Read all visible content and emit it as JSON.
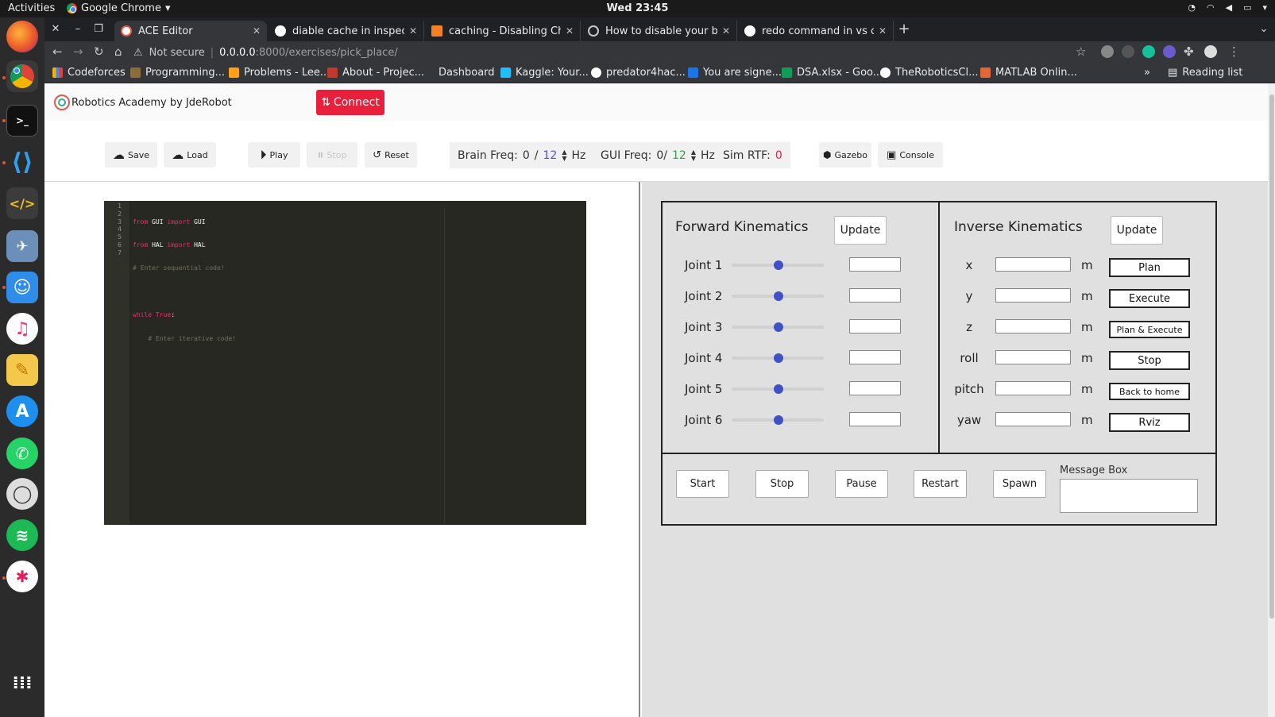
{
  "system": {
    "activities": "Activities",
    "app_name": "Google Chrome",
    "clock": "Wed 23:45"
  },
  "browser": {
    "tabs": [
      {
        "title": "ACE Editor",
        "active": true
      },
      {
        "title": "diable cache in inspect ch",
        "active": false
      },
      {
        "title": "caching - Disabling Chrom",
        "active": false
      },
      {
        "title": "How to disable your brow",
        "active": false
      },
      {
        "title": "redo command in vs code",
        "active": false
      }
    ],
    "security_label": "Not secure",
    "url_host": "0.0.0.0",
    "url_rest": ":8000/exercises/pick_place/",
    "bookmarks": [
      "Codeforces",
      "Programming...",
      "Problems - Lee...",
      "About - Projec...",
      "Dashboard",
      "Kaggle: Your...",
      "predator4hac...",
      "You are signe...",
      "DSA.xlsx - Goo...",
      "TheRoboticsCl...",
      "MATLAB Onlin..."
    ],
    "more_bookmarks": "»",
    "reading_list": "Reading list"
  },
  "app": {
    "brand": "Robotics Academy by JdeRobot",
    "connect_label": "Connect"
  },
  "toolbar": {
    "save": "Save",
    "load": "Load",
    "play": "Play",
    "stop": "Stop",
    "reset": "Reset",
    "brain_freq_label": "Brain Freq:",
    "brain_freq_value": "0",
    "brain_freq_sep": "/",
    "brain_freq_target": "12",
    "brain_freq_unit": "Hz",
    "gui_freq_label": "GUI Freq:",
    "gui_freq_value": "0/",
    "gui_freq_target": "12",
    "gui_freq_unit": "Hz",
    "sim_rtf_label": "Sim RTF:",
    "sim_rtf_value": "0",
    "gazebo": "Gazebo",
    "console": "Console"
  },
  "editor": {
    "line_numbers": [
      "1",
      "2",
      "3",
      "4",
      "5",
      "6",
      "7"
    ],
    "lines": [
      {
        "kw1": "from",
        "t1": " GUI ",
        "kw2": "import",
        "t2": " GUI"
      },
      {
        "kw1": "from",
        "t1": " HAL ",
        "kw2": "import",
        "t2": " HAL"
      },
      {
        "comment": "# Enter sequential code!"
      },
      {},
      {
        "kw1": "while",
        "t1": " ",
        "kw2": "True",
        "t2": ":"
      },
      {
        "comment": "    # Enter iterative code!"
      },
      {}
    ]
  },
  "forward_kinematics": {
    "title": "Forward Kinematics",
    "update": "Update",
    "joints": [
      {
        "label": "Joint 1",
        "value": ""
      },
      {
        "label": "Joint 2",
        "value": ""
      },
      {
        "label": "Joint 3",
        "value": ""
      },
      {
        "label": "Joint 4",
        "value": ""
      },
      {
        "label": "Joint 5",
        "value": ""
      },
      {
        "label": "Joint 6",
        "value": ""
      }
    ]
  },
  "inverse_kinematics": {
    "title": "Inverse Kinematics",
    "update": "Update",
    "rows": [
      {
        "label": "x",
        "unit": "m",
        "action": "Plan"
      },
      {
        "label": "y",
        "unit": "m",
        "action": "Execute"
      },
      {
        "label": "z",
        "unit": "m",
        "action": "Plan & Execute"
      },
      {
        "label": "roll",
        "unit": "m",
        "action": "Stop"
      },
      {
        "label": "pitch",
        "unit": "m",
        "action": "Back to home"
      },
      {
        "label": "yaw",
        "unit": "m",
        "action": "Rviz"
      }
    ]
  },
  "controls": {
    "start": "Start",
    "stop": "Stop",
    "pause": "Pause",
    "restart": "Restart",
    "spawn": "Spawn",
    "message_box_label": "Message Box",
    "message_box_value": ""
  },
  "colors": {
    "connect": "#e8203c",
    "slider_knob": "#3f51c5",
    "editor_bg": "#272822"
  }
}
